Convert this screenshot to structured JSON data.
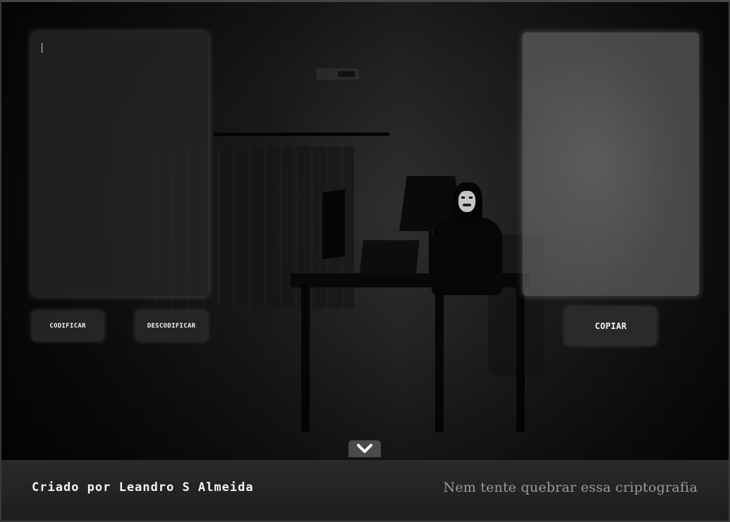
{
  "input": {
    "value": "",
    "placeholder": ""
  },
  "output": {
    "value": ""
  },
  "buttons": {
    "encode_label": "CODIFICAR",
    "decode_label": "DESCODIFICAR",
    "copy_label": "COPIAR"
  },
  "scroll_icon": "chevron-down-icon",
  "footer": {
    "credit": "Criado por Leandro S Almeida",
    "tagline": "Nem tente quebrar essa criptografia"
  },
  "colors": {
    "panel_glow": "#6ea06e",
    "background": "#0b0b0b",
    "footer": "#242424",
    "button_text": "#f2f2f2"
  }
}
